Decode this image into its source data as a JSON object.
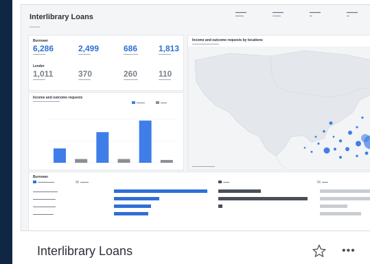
{
  "card": {
    "title": "Interlibrary Loans"
  },
  "dashboard": {
    "title": "Interlibrary Loans",
    "borrower_label": "Borrower",
    "lender_label": "Lender",
    "borrower_kpis": [
      {
        "value": "6,286",
        "color": "blue"
      },
      {
        "value": "2,499",
        "color": "blue"
      },
      {
        "value": "686",
        "color": "blue"
      },
      {
        "value": "1,813",
        "color": "blue"
      }
    ],
    "lender_kpis": [
      {
        "value": "1,011",
        "color": "grey"
      },
      {
        "value": "370",
        "color": "grey"
      },
      {
        "value": "260",
        "color": "grey"
      },
      {
        "value": "110",
        "color": "grey"
      }
    ],
    "chart_title": "Income and outcome requests",
    "map_title": "Income and outcome requests by locations",
    "table_label": "Borrower",
    "legend": {
      "borrower_color": "#3f7ee8",
      "lender_color": "#8a8f97"
    }
  },
  "chart_data": {
    "type": "bar",
    "series": [
      {
        "values": [
          46,
          98,
          135
        ]
      },
      {
        "values": [
          12,
          12,
          9
        ]
      }
    ],
    "colors": [
      "#3f7ee8",
      "#8a8f97"
    ]
  },
  "icons": {
    "star": "star-outline-icon",
    "more": "more-horizontal-icon"
  },
  "colors": {
    "background": "#0f2742",
    "accent": "#2f6fd6"
  }
}
